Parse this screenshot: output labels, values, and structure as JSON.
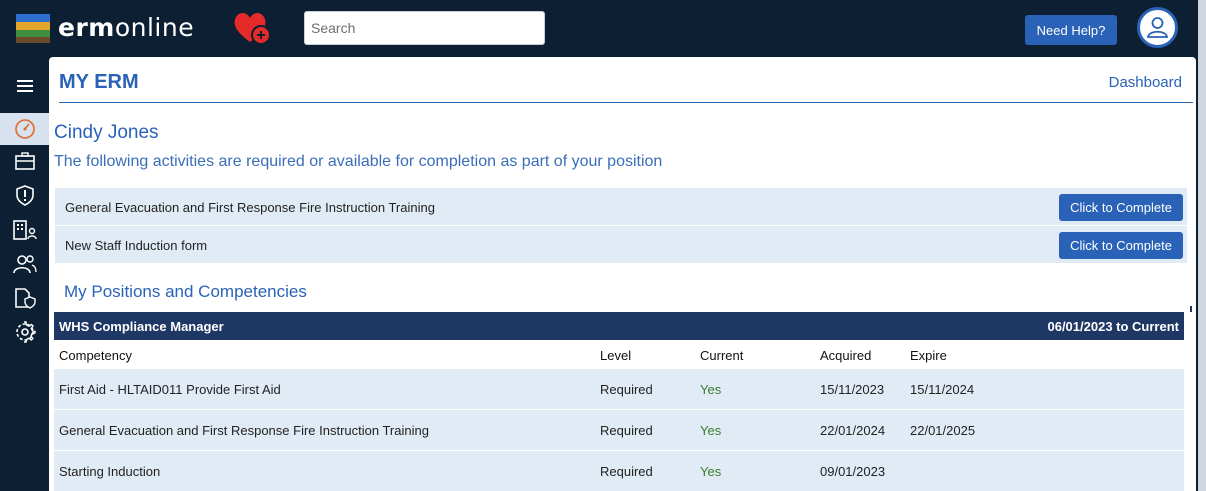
{
  "header": {
    "brand_bold": "erm",
    "brand_light": "online",
    "search_placeholder": "Search",
    "help_label": "Need Help?"
  },
  "sidebar": {
    "items": [
      {
        "icon": "menu-icon"
      },
      {
        "icon": "dashboard-gauge-icon",
        "active": true
      },
      {
        "icon": "briefcase-icon"
      },
      {
        "icon": "shield-alert-icon"
      },
      {
        "icon": "building-person-icon"
      },
      {
        "icon": "people-icon"
      },
      {
        "icon": "file-shield-icon"
      },
      {
        "icon": "gear-icon"
      }
    ]
  },
  "page": {
    "title": "MY ERM",
    "dashboard_link": "Dashboard",
    "user_name": "Cindy Jones",
    "intro": "The following activities are required or available for completion as part of your position"
  },
  "activities": [
    {
      "name": "General Evacuation and First Response Fire Instruction Training",
      "action": "Click to Complete"
    },
    {
      "name": "New Staff Induction form",
      "action": "Click to Complete"
    }
  ],
  "positions": {
    "section_title": "My Positions and Competencies",
    "position_name": "WHS Compliance Manager",
    "position_dates": "06/01/2023 to Current",
    "columns": [
      "Competency",
      "Level",
      "Current",
      "Acquired",
      "Expire"
    ],
    "rows": [
      {
        "competency": "First Aid - HLTAID011 Provide First Aid",
        "level": "Required",
        "current": "Yes",
        "acquired": "15/11/2023",
        "expire": "15/11/2024"
      },
      {
        "competency": "General Evacuation and First Response Fire Instruction Training",
        "level": "Required",
        "current": "Yes",
        "acquired": "22/01/2024",
        "expire": "22/01/2025"
      },
      {
        "competency": "Starting Induction",
        "level": "Required",
        "current": "Yes",
        "acquired": "09/01/2023",
        "expire": ""
      }
    ]
  },
  "colors": {
    "navy": "#0c1f33",
    "accent_blue": "#2a62b8",
    "row_bg": "#e1ebf5",
    "position_bar": "#1f3764",
    "yes_green": "#3a7d2a"
  }
}
